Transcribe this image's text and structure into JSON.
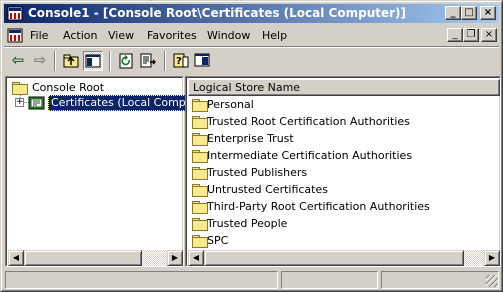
{
  "window": {
    "title": "Console1 - [Console Root\\Certificates (Local Computer)]",
    "min_glyph": "_",
    "max_glyph": "□",
    "close_glyph": "×"
  },
  "menu": {
    "items": [
      "File",
      "Action",
      "View",
      "Favorites",
      "Window",
      "Help"
    ],
    "mdi_min_glyph": "_",
    "mdi_restore_glyph": "❐",
    "mdi_close_glyph": "×"
  },
  "toolbar": {
    "back_glyph": "⇦",
    "forward_glyph": "⇨"
  },
  "tree": {
    "root_label": "Console Root",
    "expander": "+",
    "child_label": "Certificates (Local Computer)"
  },
  "list": {
    "column_header": "Logical Store Name",
    "items": [
      "Personal",
      "Trusted Root Certification Authorities",
      "Enterprise Trust",
      "Intermediate Certification Authorities",
      "Trusted Publishers",
      "Untrusted Certificates",
      "Third-Party Root Certification Authorities",
      "Trusted People",
      "SPC"
    ]
  },
  "scroll": {
    "left_arrow": "◀",
    "right_arrow": "▶"
  },
  "colors": {
    "title_start": "#0a246a",
    "title_end": "#a6caf0",
    "selection": "#0a246a",
    "face": "#d4d0c8"
  }
}
